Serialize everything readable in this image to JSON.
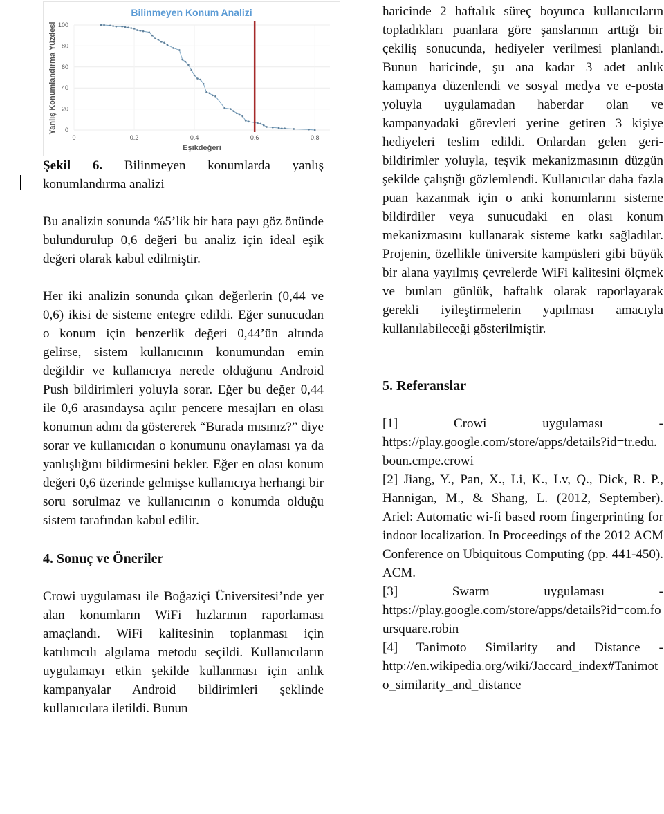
{
  "chart_data": {
    "type": "line",
    "title": "Bilinmeyen Konum Analizi",
    "xlabel": "Eşikdeğeri",
    "ylabel": "Yanlış Konumlandırma Yüzdesi",
    "xlim": [
      0,
      0.85
    ],
    "ylim": [
      0,
      100
    ],
    "xticks": [
      "0",
      "0.2",
      "0.4",
      "0.6",
      "0.8"
    ],
    "yticks": [
      "0",
      "20",
      "40",
      "60",
      "80",
      "100"
    ],
    "grid": true,
    "colors": {
      "line": "#7fa7c4",
      "marker": "#5f7f99",
      "threshold": "#a52a2a",
      "title": "#5b9bd5"
    },
    "threshold_x": 0.6,
    "x": [
      0.09,
      0.1,
      0.12,
      0.13,
      0.14,
      0.16,
      0.17,
      0.18,
      0.19,
      0.2,
      0.21,
      0.22,
      0.23,
      0.25,
      0.26,
      0.27,
      0.28,
      0.29,
      0.3,
      0.31,
      0.33,
      0.35,
      0.36,
      0.37,
      0.38,
      0.39,
      0.4,
      0.41,
      0.42,
      0.43,
      0.44,
      0.45,
      0.46,
      0.47,
      0.5,
      0.52,
      0.53,
      0.54,
      0.55,
      0.56,
      0.57,
      0.58,
      0.6,
      0.61,
      0.62,
      0.63,
      0.64,
      0.66,
      0.68,
      0.69,
      0.7,
      0.73,
      0.78,
      0.8
    ],
    "y": [
      100,
      100,
      99.5,
      99,
      98.5,
      98.5,
      98,
      97.5,
      97,
      96.5,
      95,
      94.5,
      94,
      93,
      90,
      87,
      86,
      84,
      83,
      81,
      78,
      76,
      67,
      65,
      62,
      57,
      52,
      49,
      48,
      44,
      36,
      35,
      33,
      32,
      21,
      20,
      18,
      16,
      14.5,
      13,
      9,
      8,
      7,
      6.5,
      6,
      4.5,
      3,
      2.5,
      2,
      1.5,
      1.5,
      1,
      0.5,
      0
    ]
  },
  "left": {
    "caption_label": "Şekil 6.",
    "caption_text": " Bilinmeyen konumlarda yanlış konumlandırma analizi",
    "para1": "Bu analizin sonunda %5’lik bir hata payı göz önünde bulundurulup 0,6 değeri bu analiz için ideal eşik değeri olarak kabul edilmiştir.",
    "para2": "Her iki analizin sonunda çıkan değerlerin (0,44 ve 0,6) ikisi de sisteme entegre edildi. Eğer sunucudan o konum için benzerlik değeri 0,44’ün altında gelirse, sistem kullanıcının konumundan emin değildir ve kullanıcıya nerede olduğunu Android Push bildirimleri yoluyla sorar. Eğer bu değer 0,44 ile 0,6 arasındaysa açılır pencere mesajları en olası konumun adını da göstererek “Burada mısınız?” diye sorar ve kullanıcıdan o konumunu onaylaması ya da yanlışlığını bildirmesini bekler. Eğer en olası konum değeri 0,6 üzerinde gelmişse kullanıcıya herhangi bir soru sorulmaz ve kullanıcının o konumda olduğu sistem tarafından kabul edilir.",
    "heading": "4. Sonuç ve Öneriler",
    "para3": "Crowi uygulaması ile Boğaziçi Üniversitesi’nde yer alan konumların WiFi hızlarının raporlaması amaçlandı. WiFi kalitesinin toplanması için katılımcılı algılama metodu seçildi. Kullanıcıların uygulamayı etkin şekilde kullanması için anlık kampanyalar Android bildirimleri şeklinde kullanıcılara iletildi. Bunun"
  },
  "right": {
    "para1": "haricinde 2 haftalık süreç boyunca kullanıcıların topladıkları puanlara göre şanslarının arttığı bir çekiliş sonucunda, hediyeler verilmesi planlandı. Bunun haricinde, şu ana kadar 3 adet anlık kampanya düzenlendi ve sosyal medya ve e-posta yoluyla uygulamadan haberdar olan ve kampanyadaki görevleri yerine getiren 3 kişiye hediyeleri teslim edildi. Onlardan gelen geri-bildirimler yoluyla, teşvik mekanizmasının düzgün şekilde çalıştığı gözlemlendi. Kullanıcılar daha fazla puan kazanmak için o anki konumlarını sisteme bildirdiler veya sunucudaki en olası konum mekanizmasını kullanarak sisteme katkı sağladılar. Projenin, özellikle üniversite kampüsleri gibi büyük bir alana yayılmış çevrelerde WiFi kalitesini ölçmek ve bunları günlük, haftalık olarak raporlayarak gerekli iyileştirmelerin yapılması amacıyla kullanılabileceği gösterilmiştir.",
    "heading": "5. Referanslar",
    "refs": [
      {
        "text": "[1] Crowi uygulaması -",
        "url": "https://play.google.com/store/apps/details?id=tr.edu.boun.cmpe.crowi"
      },
      {
        "text": "[2] Jiang, Y., Pan, X., Li, K., Lv, Q., Dick, R. P., Hannigan, M., & Shang, L. (2012, September). Ariel: Automatic wi-fi based room fingerprinting for indoor localization. In Proceedings of the 2012 ACM Conference on Ubiquitous Computing (pp. 441-450). ACM.",
        "url": ""
      },
      {
        "text": "[3] Swarm uygulaması -",
        "url": "https://play.google.com/store/apps/details?id=com.foursquare.robin"
      },
      {
        "text": "[4] Tanimoto Similarity and Distance -",
        "url": "http://en.wikipedia.org/wiki/Jaccard_index#Tanimoto_similarity_and_distance"
      }
    ]
  }
}
